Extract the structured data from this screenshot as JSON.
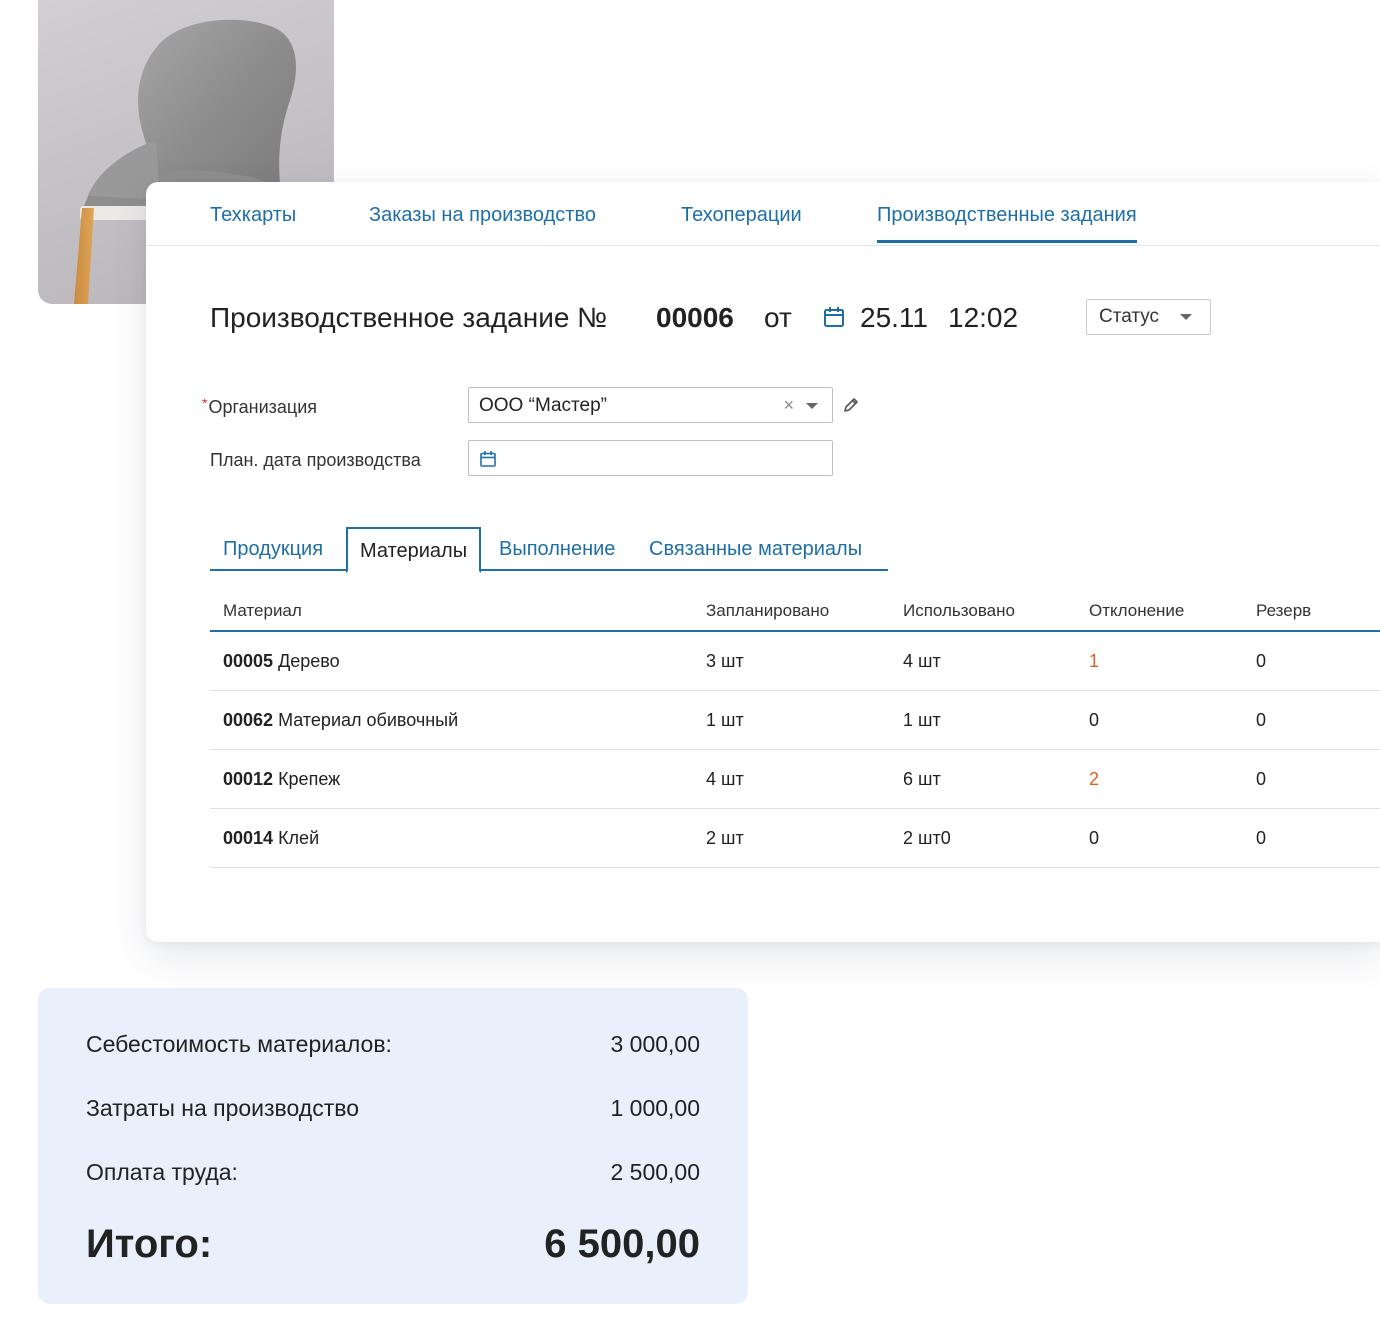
{
  "nav": {
    "tabs": [
      "Техкарты",
      "Заказы на производство",
      "Техоперации",
      "Производственные задания"
    ],
    "active": "Производственные задания"
  },
  "doc": {
    "title": "Производственное задание №",
    "number": "00006",
    "from": "от",
    "date": "25.11",
    "time": "12:02",
    "status_label": "Статус"
  },
  "form": {
    "org_label": "Организация",
    "org_required_mark": "*",
    "org_value": "ООО “Мастер”",
    "clear_glyph": "×",
    "plan_date_label": "План. дата производства",
    "plan_date_value": ""
  },
  "subtabs": {
    "items": [
      "Продукция",
      "Материалы",
      "Выполнение",
      "Связанные материалы"
    ],
    "active": "Материалы"
  },
  "table": {
    "headers": [
      "Материал",
      "Запланировано",
      "Использовано",
      "Отклонение",
      "Резерв"
    ],
    "rows": [
      {
        "code": "00005",
        "name": " Дерево",
        "planned": "3 шт",
        "used": "4 шт",
        "deviation": "1",
        "reserve": "0"
      },
      {
        "code": "00062",
        "name": " Материал обивочный",
        "planned": "1 шт",
        "used": "1 шт",
        "deviation": "0",
        "reserve": "0"
      },
      {
        "code": "00012",
        "name": " Крепеж",
        "planned": "4 шт",
        "used": "6 шт",
        "deviation": "2",
        "reserve": "0"
      },
      {
        "code": "00014",
        "name": " Клей",
        "planned": "2 шт",
        "used": "2 шт0",
        "deviation": "0",
        "reserve": "0"
      }
    ]
  },
  "summary": {
    "materials_cost_label": "Себестоимость материалов:",
    "materials_cost": "3 000,00",
    "production_cost_label": "Затраты на производство",
    "production_cost": "1 000,00",
    "labor_label": "Оплата труда:",
    "labor": "2 500,00",
    "total_label": "Итого:",
    "total": "6 500,00"
  },
  "colors": {
    "accent": "#1e6fa8",
    "warning": "#e0601c",
    "required": "#d8302d",
    "summary_bg": "#eaf0fb"
  }
}
